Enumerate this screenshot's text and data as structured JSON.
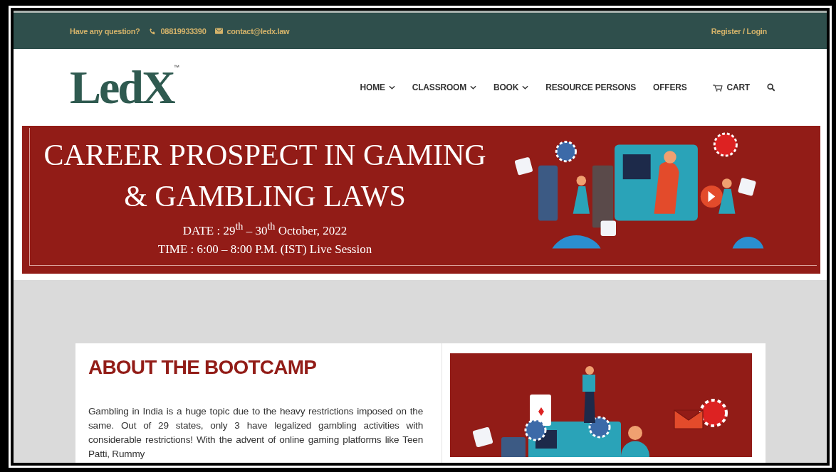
{
  "top_bar": {
    "question": "Have any question?",
    "phone": "08819933390",
    "email": "contact@ledx.law",
    "account_link": "Register / Login"
  },
  "header": {
    "logo": {
      "text": "LedX",
      "trademark": "™"
    },
    "nav": [
      {
        "label": "HOME",
        "has_dropdown": true
      },
      {
        "label": "CLASSROOM",
        "has_dropdown": true
      },
      {
        "label": "BOOK",
        "has_dropdown": true
      },
      {
        "label": "RESOURCE PERSONS",
        "has_dropdown": false
      },
      {
        "label": "OFFERS",
        "has_dropdown": false
      }
    ],
    "cart": "CART"
  },
  "banner": {
    "title_lines": [
      "CAREER PROSPECT IN GAMING",
      "& GAMBLING LAWS"
    ],
    "date": "DATE : 29$^{th}$ – 30$^{th}$ October, 2022",
    "time": "TIME : 6:00 – 8:00 P.M. (IST) Live Session"
  },
  "about": {
    "heading": "ABOUT THE BOOTCAMP",
    "paragraph": "Gambling in India is a huge topic due to the heavy restrictions imposed on the same. Out of 29 states, only 3 have legalized gambling activities with considerable restrictions! With the advent of online gaming platforms like Teen Patti, Rummy"
  }
}
